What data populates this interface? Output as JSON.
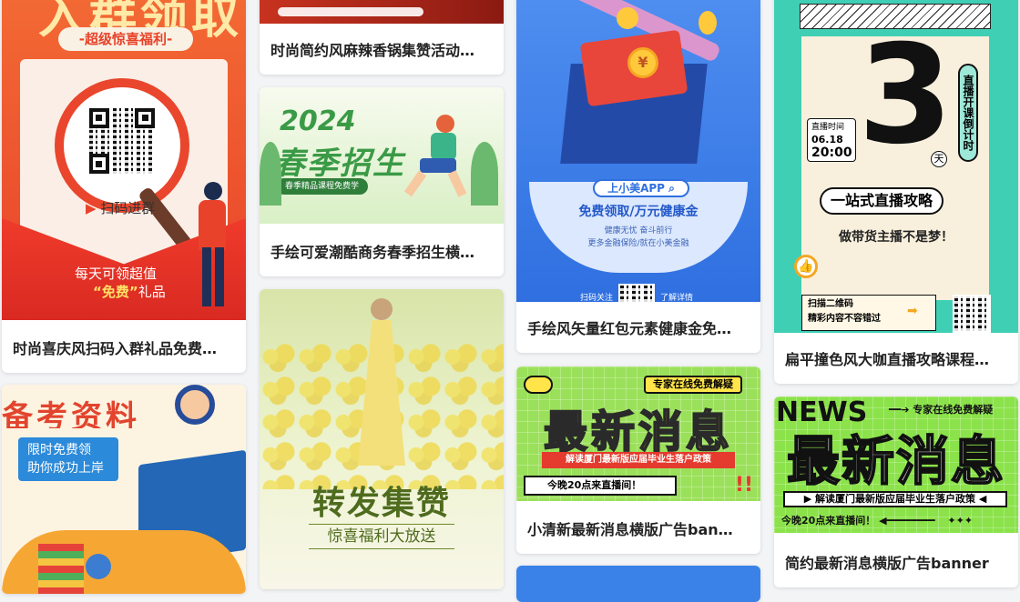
{
  "cards": [
    {
      "caption": "时尚喜庆风扫码入群礼品免费…",
      "poster": {
        "headline": "入群领取",
        "badge": "-超级惊喜福利-",
        "scan": "扫码进群",
        "bottom1": "每天可领超值",
        "bottom2_hl": "“免费”",
        "bottom2_rest": "礼品"
      }
    },
    {
      "caption": "",
      "poster": {
        "headline": "备考资料",
        "line1": "限时免费领",
        "line2": "助你成功上岸"
      }
    },
    {
      "caption": "时尚简约风麻辣香锅集赞活动…",
      "poster": {}
    },
    {
      "caption": "手绘可爱潮酷商务春季招生横…",
      "poster": {
        "year": "2024",
        "title": "春季招生",
        "tag": "春季精品课程免费学"
      }
    },
    {
      "caption": "",
      "poster": {
        "title": "转发集赞",
        "subtitle": "惊喜福利大放送"
      }
    },
    {
      "caption": "手绘风矢量红包元素健康金免…",
      "poster": {
        "app": "上小美APP",
        "headline": "免费领取/万元健康金",
        "small1": "健康无忧 奋斗前行",
        "small2": "更多金融保险/就在小美金融",
        "scan": "扫码关注",
        "more": "了解详情"
      }
    },
    {
      "caption": "小清新最新消息横版广告ban…",
      "poster": {
        "badge": "专家在线免费解疑",
        "title": "最新消息",
        "strip": "解读厦门最新版应届毕业生落户政策",
        "live": "今晚20点来直播间！"
      }
    },
    {
      "caption": "扁平撞色风大咖直播攻略课程…",
      "poster": {
        "big_number": "3",
        "day": "天",
        "vertical": "直播开课倒计时",
        "date_label": "直播时间",
        "date": "06.18",
        "time": "20:00",
        "pill": "一站式直播攻略",
        "line": "做带货主播不是梦！",
        "scan1": "扫描二维码",
        "scan2": "精彩内容不容错过"
      }
    },
    {
      "caption": "简约最新消息横版广告banner",
      "poster": {
        "news": "NEWS",
        "badge": "专家在线免费解疑",
        "title": "最新消息",
        "strip": "解读厦门最新版应届毕业生落户政策",
        "live": "今晚20点来直播间！"
      }
    }
  ]
}
